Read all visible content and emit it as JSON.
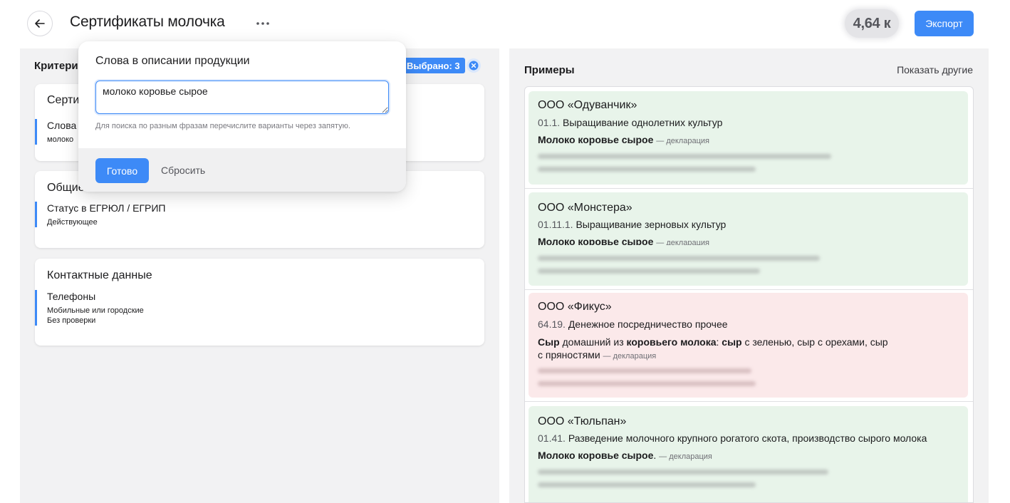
{
  "header": {
    "title": "Сертификаты молочка",
    "count": "4,64 к",
    "export_label": "Экспорт"
  },
  "criteria": {
    "title": "Критери",
    "selected_label": "Выбрано: 3",
    "cards": [
      {
        "title": "Серти",
        "items": [
          {
            "title": "Слова",
            "lines": [
              "молоко"
            ]
          }
        ]
      },
      {
        "title": "Общие",
        "items": [
          {
            "title": "Статус в ЕГРЮЛ / ЕГРИП",
            "lines": [
              "Действующее"
            ]
          }
        ]
      },
      {
        "title": "Контактные данные",
        "items": [
          {
            "title": "Телефоны",
            "lines": [
              "Мобильные или городские",
              "Без проверки"
            ]
          }
        ]
      }
    ]
  },
  "popover": {
    "title": "Слова в описании продукции",
    "input_value": "молоко коровье сырое",
    "hint": "Для поиска по разным фразам перечислите варианты через запятую.",
    "done_label": "Готово",
    "reset_label": "Сбросить"
  },
  "examples": {
    "title": "Примеры",
    "show_more": "Показать другие",
    "items": [
      {
        "name": "ООО «Одуванчик»",
        "code": "01.1.",
        "activity": "Выращивание однолетних культур",
        "product_bold": "Молоко коровье сырое",
        "product_rest": "",
        "note": "— декларация",
        "status": "green"
      },
      {
        "name": "ООО «Монстера»",
        "code": "01.11.1.",
        "activity": "Выращивание зерновых культур",
        "product_bold": "Молоко коровье сырое",
        "product_rest": "",
        "note": "— декларация",
        "status": "green"
      },
      {
        "name": "ООО «Фикус»",
        "code": "64.19.",
        "activity": "Денежное посредничество прочее",
        "product_parts": [
          {
            "text": "Сыр",
            "bold": true
          },
          {
            "text": " домашний из ",
            "bold": false
          },
          {
            "text": "коровьего молока",
            "bold": true
          },
          {
            "text": ": ",
            "bold": false
          },
          {
            "text": "сыр",
            "bold": true
          },
          {
            "text": " с зеленью, сыр с орехами, сыр с пряностями",
            "bold": false
          }
        ],
        "note": "— декларация",
        "status": "red"
      },
      {
        "name": "ООО «Тюльпан»",
        "code": "01.41.",
        "activity": "Разведение молочного крупного рогатого скота, производство сырого молока",
        "product_bold": "Молоко коровье сырое",
        "product_rest": ".",
        "note": "— декларация",
        "status": "green"
      }
    ]
  },
  "colors": {
    "accent": "#3d8af7",
    "match_bg": "#e8f4ea",
    "mismatch_bg": "#fbe9ea",
    "panel_bg": "#f2f2f3"
  },
  "icons": {
    "back": "arrow-left-icon",
    "more": "ellipsis-icon",
    "clear": "close-circle-icon"
  }
}
